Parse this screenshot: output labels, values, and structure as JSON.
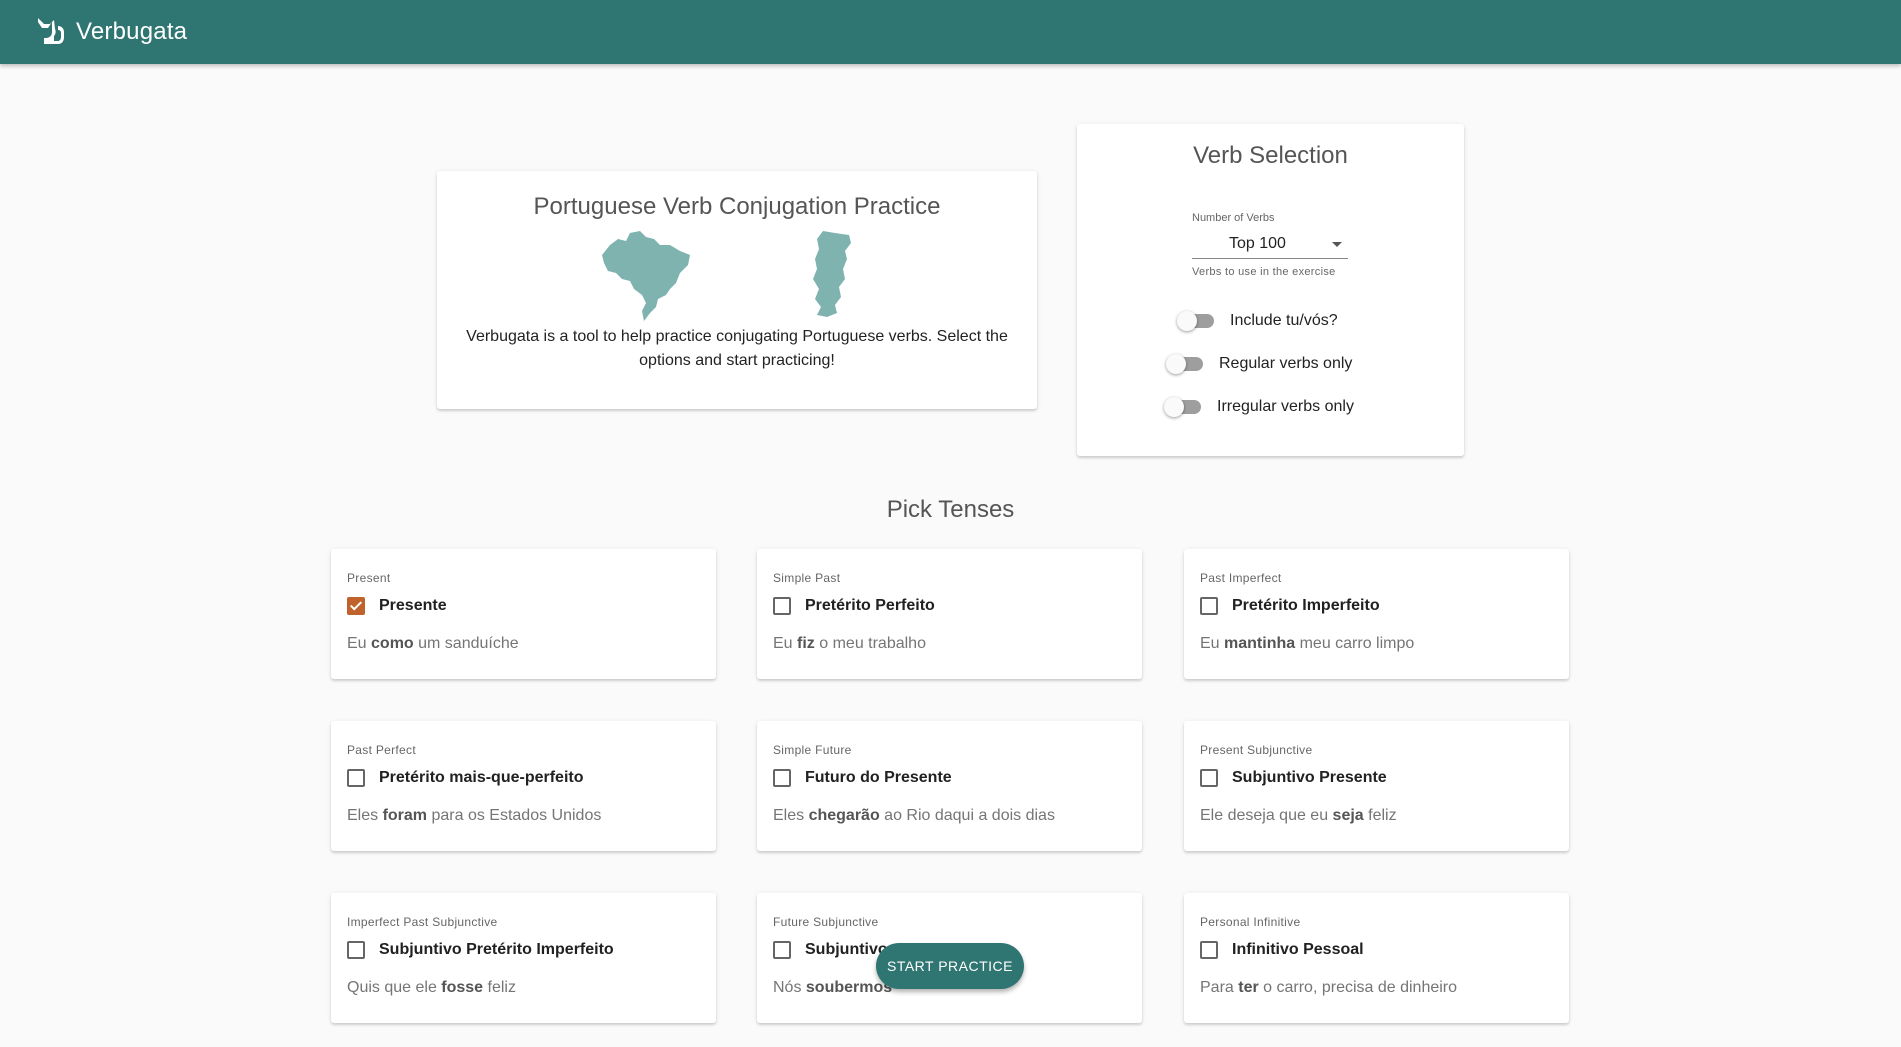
{
  "app": {
    "title": "Verbugata",
    "logo_icon": "cat-icon"
  },
  "intro": {
    "title": "Portuguese Verb Conjugation Practice",
    "map_color": "#7fb3b0",
    "description": "Verbugata is a tool to help practice conjugating Portuguese verbs. Select the options and start practicing!"
  },
  "verb_selection": {
    "title": "Verb Selection",
    "number_label": "Number of Verbs",
    "number_value": "Top 100",
    "number_hint": "Verbs to use in the exercise",
    "toggles": [
      {
        "label": "Include tu/vós?",
        "on": false
      },
      {
        "label": "Regular verbs only",
        "on": false
      },
      {
        "label": "Irregular verbs only",
        "on": false
      }
    ]
  },
  "tenses_title": "Pick Tenses",
  "tenses": [
    {
      "category": "Present",
      "name": "Presente",
      "checked": true,
      "ex_pre": "Eu ",
      "ex_verb": "como",
      "ex_post": " um sanduíche"
    },
    {
      "category": "Simple Past",
      "name": "Pretérito Perfeito",
      "checked": false,
      "ex_pre": "Eu ",
      "ex_verb": "fiz",
      "ex_post": " o meu trabalho"
    },
    {
      "category": "Past Imperfect",
      "name": "Pretérito Imperfeito",
      "checked": false,
      "ex_pre": "Eu ",
      "ex_verb": "mantinha",
      "ex_post": " meu carro limpo"
    },
    {
      "category": "Past Perfect",
      "name": "Pretérito mais-que-perfeito",
      "checked": false,
      "ex_pre": "Eles ",
      "ex_verb": "foram",
      "ex_post": " para os Estados Unidos"
    },
    {
      "category": "Simple Future",
      "name": "Futuro do Presente",
      "checked": false,
      "ex_pre": "Eles ",
      "ex_verb": "chegarão",
      "ex_post": " ao Rio daqui a dois dias"
    },
    {
      "category": "Present Subjunctive",
      "name": "Subjuntivo Presente",
      "checked": false,
      "ex_pre": "Ele deseja que eu ",
      "ex_verb": "seja",
      "ex_post": " feliz"
    },
    {
      "category": "Imperfect Past Subjunctive",
      "name": "Subjuntivo Pretérito Imperfeito",
      "checked": false,
      "ex_pre": "Quis que ele ",
      "ex_verb": "fosse",
      "ex_post": " feliz"
    },
    {
      "category": "Future Subjunctive",
      "name": "Subjuntivo",
      "checked": false,
      "ex_pre": "Nós ",
      "ex_verb": "soubermos",
      "ex_post": ""
    },
    {
      "category": "Personal Infinitive",
      "name": "Infinitivo Pessoal",
      "checked": false,
      "ex_pre": "Para ",
      "ex_verb": "ter",
      "ex_post": " o carro, precisa de dinheiro"
    }
  ],
  "fab_label": "START PRACTICE",
  "colors": {
    "primary": "#2f7571",
    "accent": "#c0622b"
  }
}
